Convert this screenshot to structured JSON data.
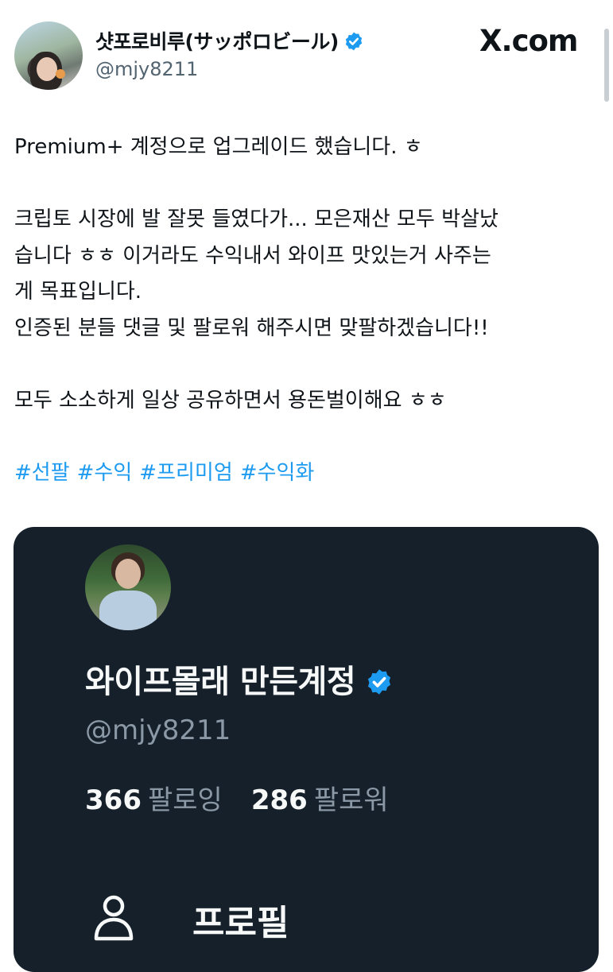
{
  "author": {
    "display_name": "샷포로비루(サッポロビール)",
    "handle": "@mjy8211"
  },
  "header": {
    "brand": "X.com"
  },
  "tweet": {
    "text": "Premium+ 계정으로 업그레이드 했습니다. ㅎ\n\n크립토 시장에 발 잘못 들였다가... 모은재산 모두 박살났\n습니다 ㅎㅎ 이거라도 수익내서 와이프 맛있는거 사주는\n게 목표입니다.\n인증된 분들 댓글 및 팔로워 해주시면 맞팔하겠습니다!!\n\n모두 소소하게 일상 공유하면서 용돈벌이해요 ㅎㅎ",
    "hashtags": [
      "#선팔",
      "#수익",
      "#프리미엄",
      "#수익화"
    ]
  },
  "profile_card": {
    "name": "와이프몰래 만든계정",
    "handle": "@mjy8211",
    "following_count": "366",
    "following_label": "팔로잉",
    "followers_count": "286",
    "followers_label": "팔로워",
    "profile_menu_label": "프로필"
  },
  "colors": {
    "link": "#1d9bf0",
    "verified": "#1d9bf0",
    "card_bg": "#15202b"
  },
  "icons": [
    "verified-badge-icon",
    "person-icon"
  ]
}
